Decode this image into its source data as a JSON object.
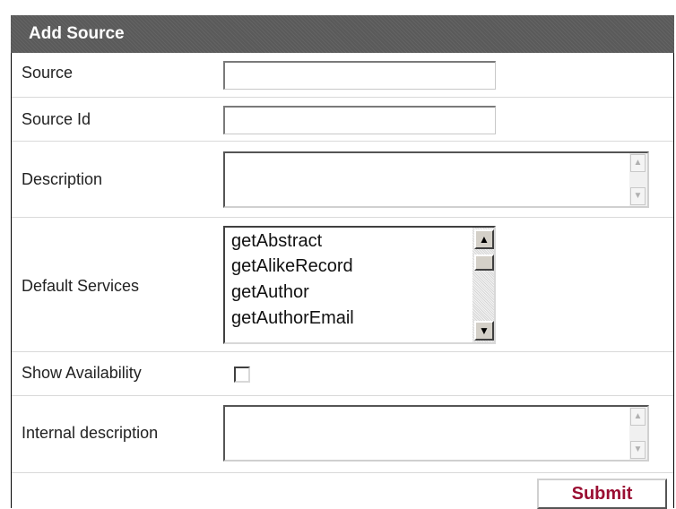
{
  "header": {
    "title": "Add Source"
  },
  "form": {
    "source": {
      "label": "Source",
      "value": ""
    },
    "source_id": {
      "label": "Source Id",
      "value": ""
    },
    "description": {
      "label": "Description",
      "value": ""
    },
    "default_services": {
      "label": "Default Services",
      "items": [
        "getAbstract",
        "getAlikeRecord",
        "getAuthor",
        "getAuthorEmail"
      ]
    },
    "show_availability": {
      "label": "Show Availability",
      "checked": false
    },
    "internal_description": {
      "label": "Internal description",
      "value": ""
    },
    "submit_label": "Submit"
  },
  "colors": {
    "header_bg": "#5a5a5a",
    "submit_text": "#9a0e32"
  },
  "icons": {
    "scroll_up": "▲",
    "scroll_down": "▼"
  }
}
